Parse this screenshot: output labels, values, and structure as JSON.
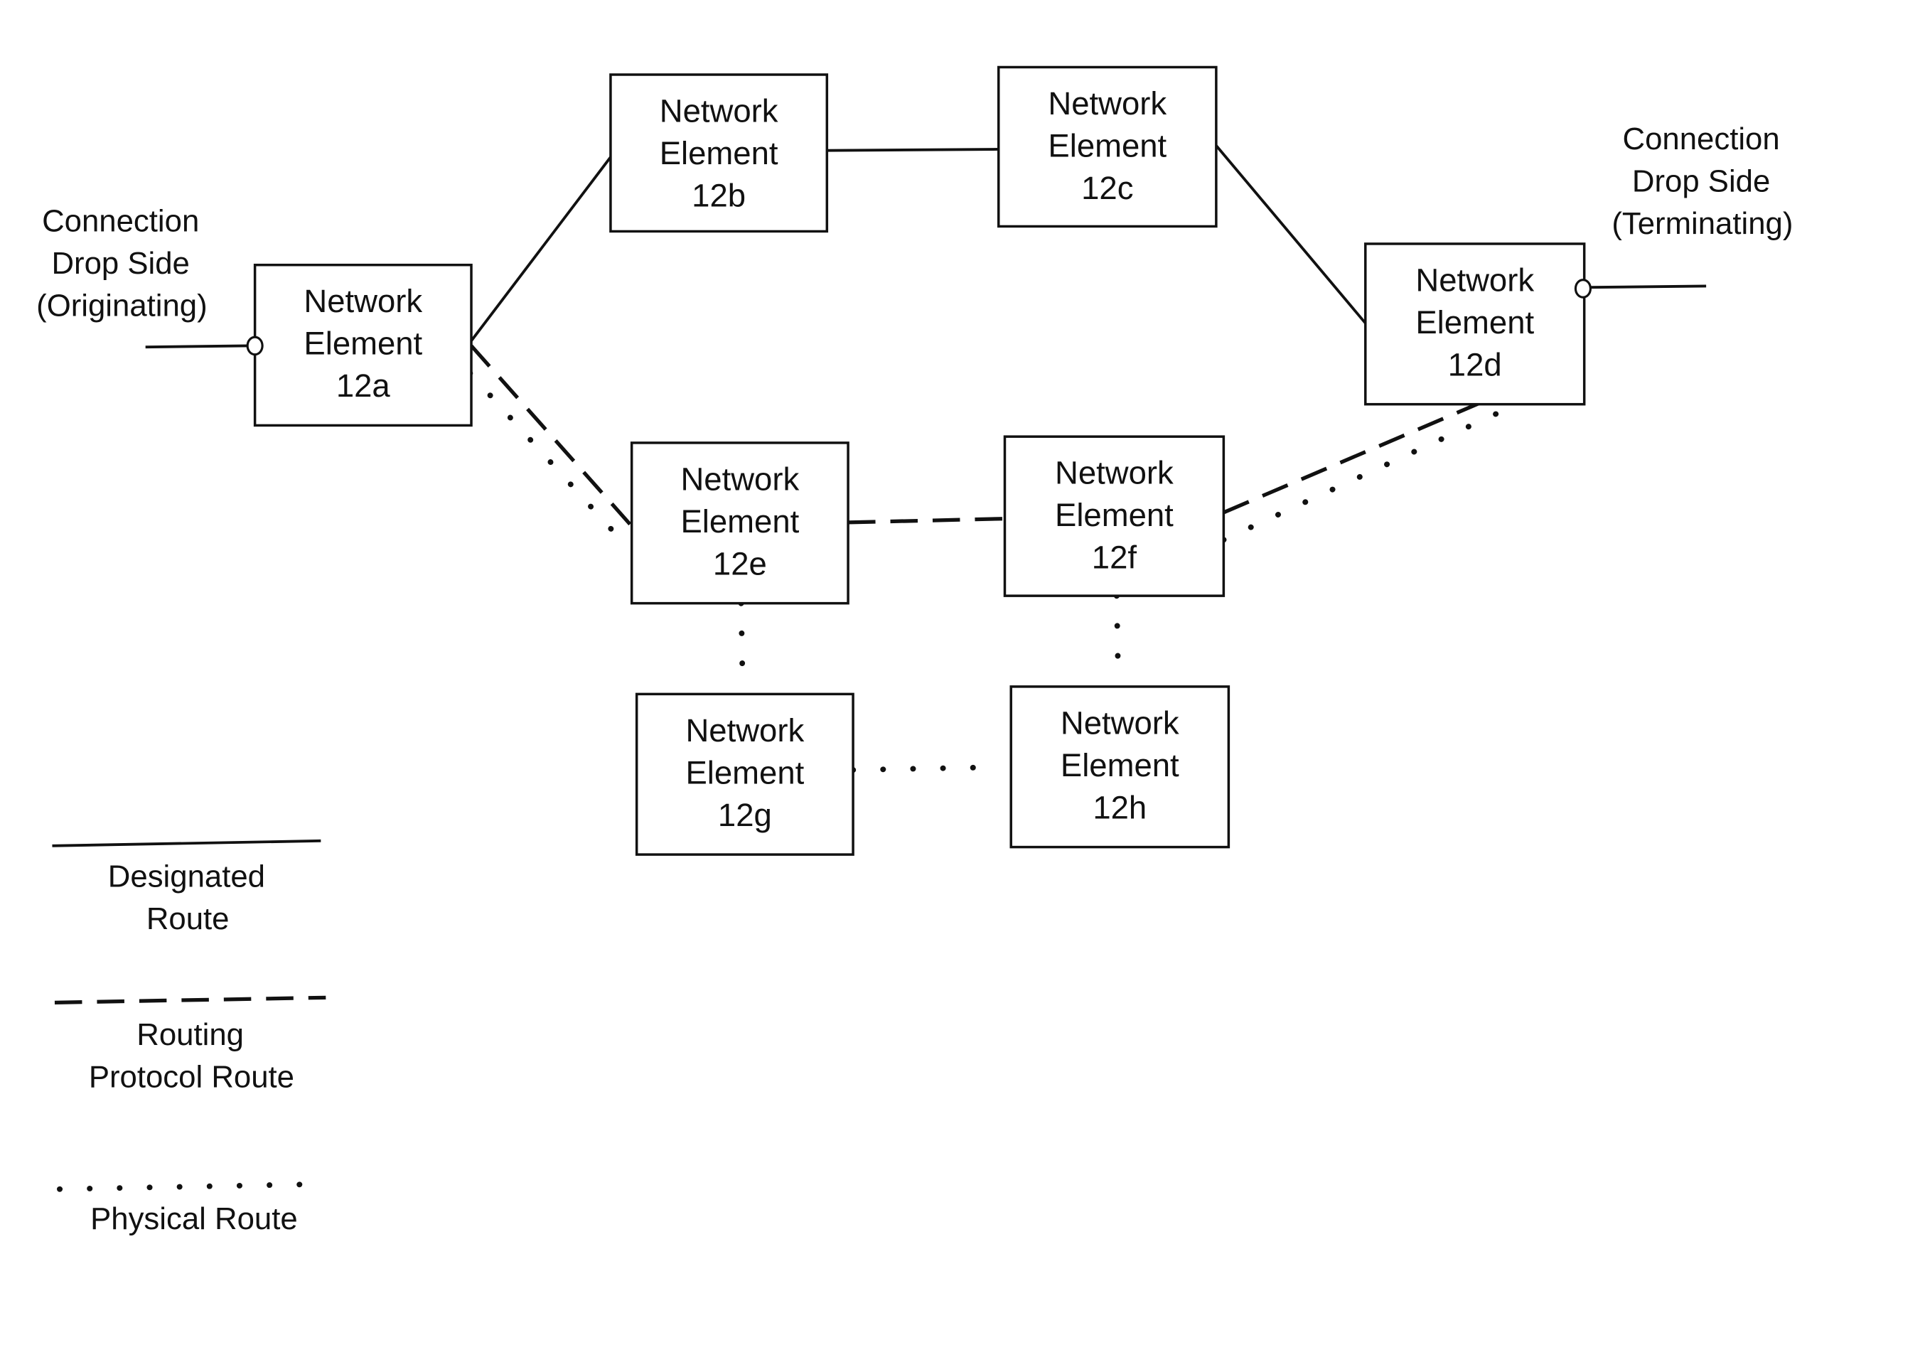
{
  "diagram": {
    "nodes": [
      {
        "id": "12a",
        "lines": [
          "Network",
          "Element",
          "12a"
        ]
      },
      {
        "id": "12b",
        "lines": [
          "Network",
          "Element",
          "12b"
        ]
      },
      {
        "id": "12c",
        "lines": [
          "Network",
          "Element",
          "12c"
        ]
      },
      {
        "id": "12d",
        "lines": [
          "Network",
          "Element",
          "12d"
        ]
      },
      {
        "id": "12e",
        "lines": [
          "Network",
          "Element",
          "12e"
        ]
      },
      {
        "id": "12f",
        "lines": [
          "Network",
          "Element",
          "12f"
        ]
      },
      {
        "id": "12g",
        "lines": [
          "Network",
          "Element",
          "12g"
        ]
      },
      {
        "id": "12h",
        "lines": [
          "Network",
          "Element",
          "12h"
        ]
      }
    ],
    "edges": [
      {
        "from": "12a",
        "to": "12b",
        "type": "designated"
      },
      {
        "from": "12b",
        "to": "12c",
        "type": "designated"
      },
      {
        "from": "12c",
        "to": "12d",
        "type": "designated"
      },
      {
        "from": "12a",
        "to": "12e",
        "type": "routing-protocol"
      },
      {
        "from": "12e",
        "to": "12f",
        "type": "routing-protocol"
      },
      {
        "from": "12f",
        "to": "12d",
        "type": "routing-protocol"
      },
      {
        "from": "12a",
        "to": "12e",
        "type": "physical"
      },
      {
        "from": "12f",
        "to": "12d",
        "type": "physical"
      },
      {
        "from": "12e",
        "to": "12g",
        "type": "physical"
      },
      {
        "from": "12f",
        "to": "12h",
        "type": "physical"
      },
      {
        "from": "12g",
        "to": "12h",
        "type": "physical"
      }
    ],
    "originating": {
      "lines": [
        "Connection",
        "Drop Side",
        "(Originating)"
      ],
      "attached_to": "12a"
    },
    "terminating": {
      "lines": [
        "Connection",
        "Drop Side",
        "(Terminating)"
      ],
      "attached_to": "12d"
    }
  },
  "legend": {
    "items": [
      {
        "type": "designated",
        "lines": [
          "Designated",
          "Route"
        ]
      },
      {
        "type": "routing-protocol",
        "lines": [
          "Routing",
          "Protocol Route"
        ]
      },
      {
        "type": "physical",
        "lines": [
          "Physical Route"
        ]
      }
    ]
  }
}
